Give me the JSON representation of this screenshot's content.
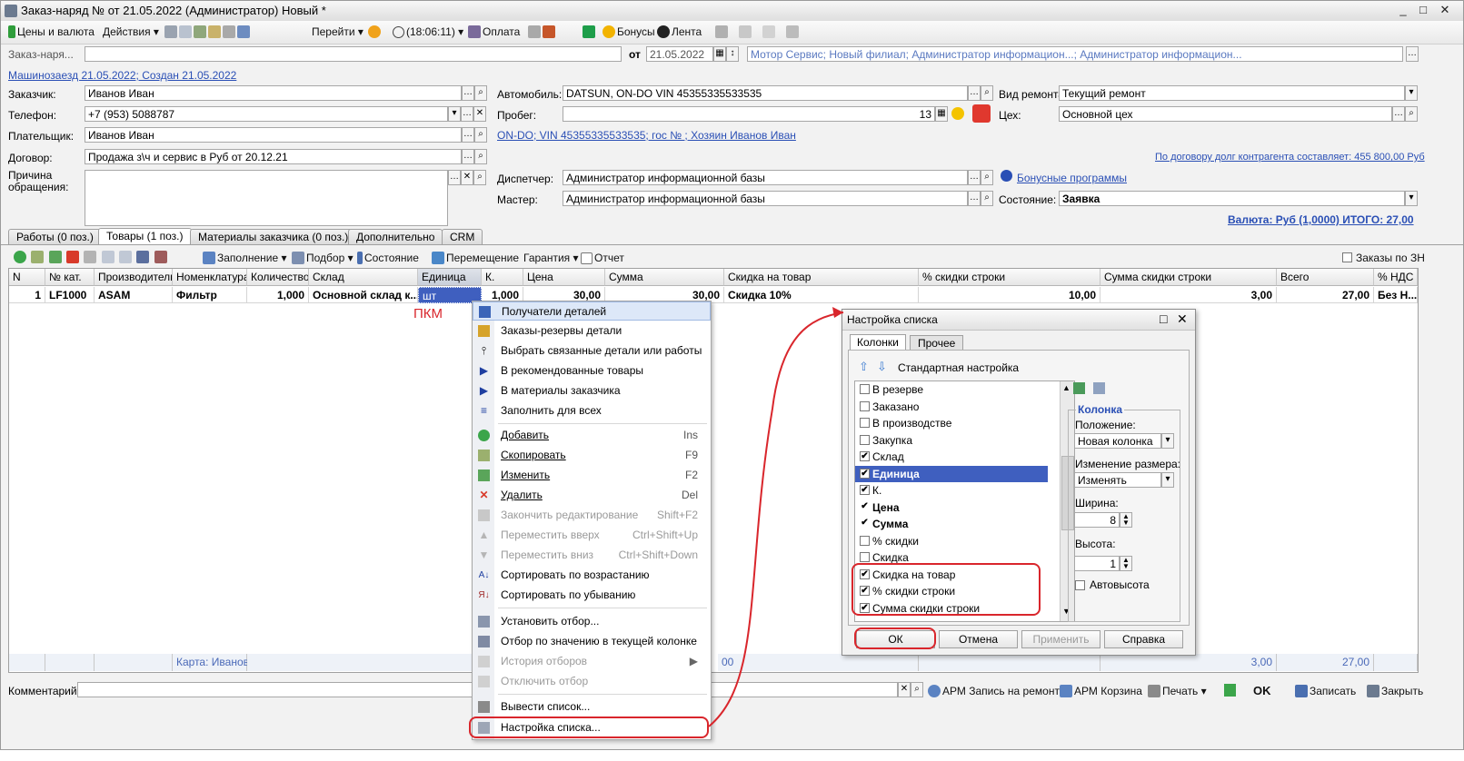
{
  "window": {
    "title": "Заказ-наряд № от 21.05.2022 (Администратор) Новый *",
    "min": "_",
    "max": "□",
    "close": "✕"
  },
  "toolbar": {
    "prices": "Цены и валюта",
    "actions": "Действия ▾",
    "goto": "Перейти ▾",
    "time": "(18:06:11) ▾",
    "payment": "Оплата",
    "bonuses": "Бонусы",
    "feed": "Лента"
  },
  "header": {
    "doc_label": "Заказ-наря...",
    "doc_number": "",
    "date_label": "от",
    "date": "21.05.2022",
    "org": "Мотор Сервис; Новый филиал; Администратор информацион...; Администратор информацион...",
    "link": "Машинозаезд 21.05.2022; Создан 21.05.2022"
  },
  "form": {
    "customer_label": "Заказчик:",
    "customer": "Иванов Иван",
    "phone_label": "Телефон:",
    "phone": "+7 (953) 5088787",
    "payer_label": "Плательщик:",
    "payer": "Иванов Иван",
    "contract_label": "Договор:",
    "contract": "Продажа з\\ч и сервис в Руб от 20.12.21",
    "reason_label": "Причина обращения:",
    "reason": "",
    "car_label": "Автомобиль:",
    "car": "DATSUN, ON-DO VIN 45355335533535",
    "mileage_label": "Пробег:",
    "mileage": "13",
    "car_link": "ON-DO; VIN 45355335533535; гос № ; Хозяин Иванов Иван",
    "dispatcher_label": "Диспетчер:",
    "dispatcher": "Администратор информационной базы",
    "master_label": "Мастер:",
    "master": "Администратор информационной базы",
    "repair_label": "Вид ремонта:",
    "repair": "Текущий ремонт",
    "shop_label": "Цех:",
    "shop": "Основной цех",
    "debt_link": "По договору долг контрагента составляет: 455 800,00 Руб",
    "bonus_link": "Бонусные программы",
    "state_label": "Состояние:",
    "state": "Заявка",
    "total": "Валюта: Руб (1,0000) ИТОГО: 27,00"
  },
  "tabs": [
    {
      "label": "Работы (0 поз.)"
    },
    {
      "label": "Товары (1 поз.)"
    },
    {
      "label": "Материалы заказчика (0 поз.)"
    },
    {
      "label": "Дополнительно"
    },
    {
      "label": "CRM"
    }
  ],
  "grid_toolbar": {
    "fill": "Заполнение ▾",
    "pick": "Подбор ▾",
    "state": "Состояние",
    "move": "Перемещение",
    "warranty": "Гарантия ▾",
    "report": "Отчет",
    "orders": "Заказы по ЗН"
  },
  "grid": {
    "columns": [
      "N",
      "№ кат.",
      "Производитель",
      "Номенклатура",
      "Количество",
      "Склад",
      "Единица",
      "К.",
      "Цена",
      "Сумма",
      "Скидка на товар",
      "% скидки строки",
      "Сумма скидки строки",
      "Всего",
      "% НДС"
    ],
    "row": [
      "1",
      "LF1000",
      "ASAM",
      "Фильтр",
      "1,000",
      "Основной склад к...",
      "шт",
      "1,000",
      "30,00",
      "30,00",
      "Скидка 10%",
      "10,00",
      "3,00",
      "27,00",
      "Без Н..."
    ],
    "footer_card": "Карта: Иванов",
    "footer_00": "00",
    "footer_discount": "3,00",
    "footer_total": "27,00"
  },
  "annotation": "ПКМ",
  "context_menu": [
    {
      "label": "Получатели деталей",
      "shortcut": ""
    },
    {
      "label": "Заказы-резервы детали",
      "shortcut": ""
    },
    {
      "label": "Выбрать связанные детали или работы",
      "shortcut": ""
    },
    {
      "label": "В рекомендованные товары",
      "shortcut": ""
    },
    {
      "label": "В материалы заказчика",
      "shortcut": ""
    },
    {
      "label": "Заполнить для всех",
      "shortcut": ""
    },
    {
      "label": "Добавить",
      "shortcut": "Ins"
    },
    {
      "label": "Скопировать",
      "shortcut": "F9"
    },
    {
      "label": "Изменить",
      "shortcut": "F2"
    },
    {
      "label": "Удалить",
      "shortcut": "Del"
    },
    {
      "label": "Закончить редактирование",
      "shortcut": "Shift+F2"
    },
    {
      "label": "Переместить вверх",
      "shortcut": "Ctrl+Shift+Up"
    },
    {
      "label": "Переместить вниз",
      "shortcut": "Ctrl+Shift+Down"
    },
    {
      "label": "Сортировать по возрастанию",
      "shortcut": ""
    },
    {
      "label": "Сортировать по убыванию",
      "shortcut": ""
    },
    {
      "label": "Установить отбор...",
      "shortcut": ""
    },
    {
      "label": "Отбор по значению в текущей колонке",
      "shortcut": ""
    },
    {
      "label": "История отборов",
      "shortcut": "▶"
    },
    {
      "label": "Отключить отбор",
      "shortcut": ""
    },
    {
      "label": "Вывести список...",
      "shortcut": ""
    },
    {
      "label": "Настройка списка...",
      "shortcut": ""
    }
  ],
  "dialog": {
    "title": "Настройка списка",
    "tabs": [
      "Колонки",
      "Прочее"
    ],
    "std": "Стандартная настройка",
    "columns": [
      {
        "label": "В резерве",
        "checked": ""
      },
      {
        "label": "Заказано",
        "checked": ""
      },
      {
        "label": "В производстве",
        "checked": ""
      },
      {
        "label": "Закупка",
        "checked": ""
      },
      {
        "label": "Склад",
        "checked": "✔"
      },
      {
        "label": "Единица",
        "checked": "✔"
      },
      {
        "label": "К.",
        "checked": "✔"
      },
      {
        "label": "Цена",
        "checked": "✔"
      },
      {
        "label": "Сумма",
        "checked": "✔"
      },
      {
        "label": "% скидки",
        "checked": ""
      },
      {
        "label": "Скидка",
        "checked": ""
      },
      {
        "label": "Скидка на товар",
        "checked": "✔"
      },
      {
        "label": "% скидки строки",
        "checked": "✔"
      },
      {
        "label": "Сумма скидки строки",
        "checked": "✔"
      }
    ],
    "group": "Колонка",
    "position_label": "Положение:",
    "position": "Новая колонка",
    "resize_label": "Изменение размера:",
    "resize": "Изменять",
    "width_label": "Ширина:",
    "width": "8",
    "height_label": "Высота:",
    "height": "1",
    "autoheight": "Автовысота",
    "ok": "ОК",
    "cancel": "Отмена",
    "apply": "Применить",
    "help": "Справка"
  },
  "bottom": {
    "comment_label": "Комментарий:",
    "comment": "",
    "arm_repair": "АРМ Запись на ремонт",
    "arm_cart": "АРМ Корзина",
    "print": "Печать ▾",
    "ok": "OK",
    "save": "Записать",
    "close": "Закрыть"
  },
  "colors": {
    "accent": "#2a4fb5",
    "highlight": "#3f5fbf",
    "annotation": "#d9262c"
  }
}
